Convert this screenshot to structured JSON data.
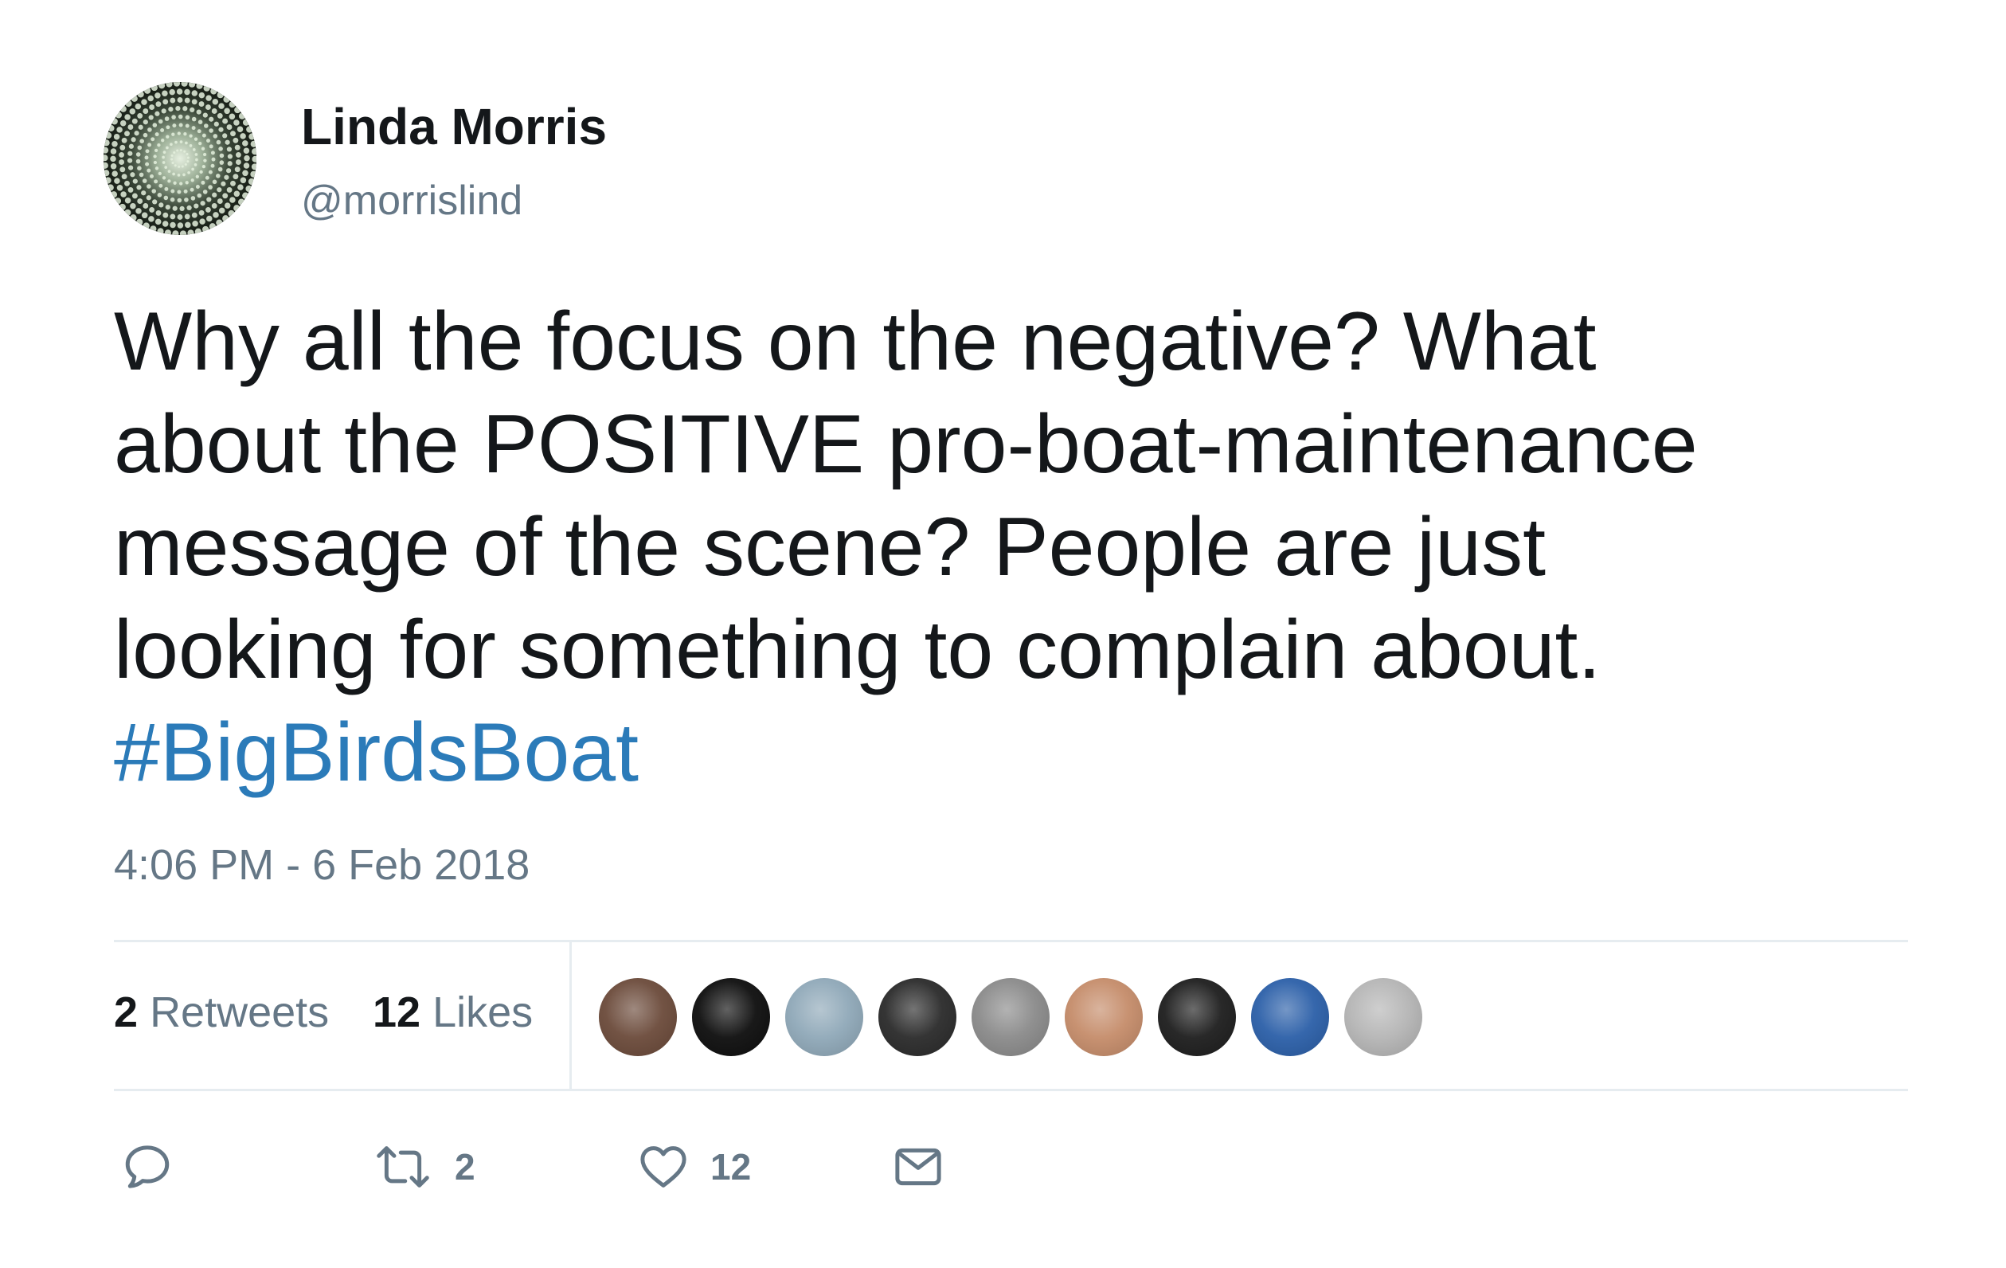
{
  "user": {
    "display_name": "Linda Morris",
    "handle": "@morrislind",
    "avatar_icon": "avatar-pattern"
  },
  "tweet": {
    "text_lines": [
      "Why all the focus on the negative? What",
      "about the POSITIVE pro-boat-maintenance",
      "message of the scene? People are just",
      "looking for something to complain about."
    ],
    "hashtag": "#BigBirdsBoat",
    "timestamp": "4:06 PM - 6 Feb 2018"
  },
  "stats": {
    "retweets_count": "2",
    "retweets_label": "Retweets",
    "likes_count": "12",
    "likes_label": "Likes"
  },
  "likers": [
    {
      "name": "liker-1",
      "color": "#6b4a3a"
    },
    {
      "name": "liker-2",
      "color": "#0d0d0d"
    },
    {
      "name": "liker-3",
      "color": "#8fa8b8"
    },
    {
      "name": "liker-4",
      "color": "#2a2a2a"
    },
    {
      "name": "liker-5",
      "color": "#8a8a8a"
    },
    {
      "name": "liker-6",
      "color": "#c58c6a"
    },
    {
      "name": "liker-7",
      "color": "#1d1d1d"
    },
    {
      "name": "liker-8",
      "color": "#2b5fa8"
    },
    {
      "name": "liker-9",
      "color": "#b5b5b5"
    }
  ],
  "actions": {
    "reply_icon": "reply-icon",
    "retweet_icon": "retweet-icon",
    "retweet_count": "2",
    "like_icon": "heart-icon",
    "like_count": "12",
    "dm_icon": "envelope-icon"
  },
  "colors": {
    "text": "#14171a",
    "secondary": "#657786",
    "link": "#2b7bb9",
    "divider": "#e6ecf0"
  }
}
